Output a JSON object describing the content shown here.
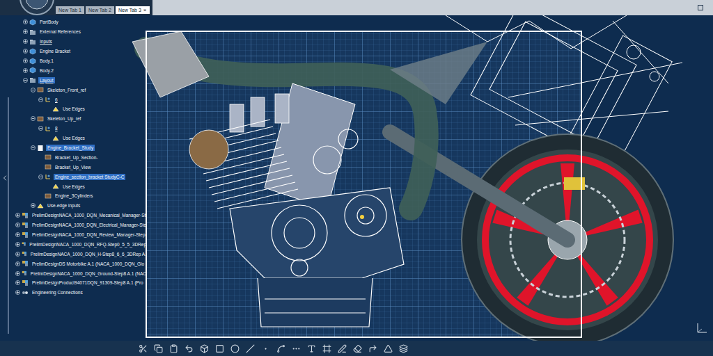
{
  "window": {
    "title": "New Tab 3"
  },
  "tabs": [
    {
      "label": "New Tab 1",
      "selected": false,
      "close": ""
    },
    {
      "label": "New Tab 2",
      "selected": false,
      "close": ""
    },
    {
      "label": "New Tab 3",
      "selected": true,
      "close": "×"
    }
  ],
  "tree": [
    {
      "label": "PartBody",
      "level": 1,
      "kind": "part",
      "expandable": true,
      "expanded": false,
      "selected": false,
      "underlined": false
    },
    {
      "label": "External References",
      "level": 1,
      "kind": "folder",
      "expandable": true,
      "expanded": false,
      "selected": false,
      "underlined": false
    },
    {
      "label": "Inputs",
      "level": 1,
      "kind": "folder",
      "expandable": true,
      "expanded": false,
      "selected": false,
      "underlined": true
    },
    {
      "label": "Engine Bracket",
      "level": 1,
      "kind": "part",
      "expandable": true,
      "expanded": false,
      "selected": false,
      "underlined": false
    },
    {
      "label": "Body.1",
      "level": 1,
      "kind": "part",
      "expandable": true,
      "expanded": false,
      "selected": false,
      "underlined": false
    },
    {
      "label": "Body.2",
      "level": 1,
      "kind": "part",
      "expandable": true,
      "expanded": false,
      "selected": false,
      "underlined": false
    },
    {
      "label": "Layout",
      "level": 1,
      "kind": "folder",
      "expandable": true,
      "expanded": true,
      "selected": true,
      "underlined": true
    },
    {
      "label": "Skeleton_Front_ref",
      "level": 2,
      "kind": "sketch",
      "expandable": true,
      "expanded": true,
      "selected": false,
      "underlined": false
    },
    {
      "label": "6",
      "level": 3,
      "kind": "axis",
      "expandable": true,
      "expanded": true,
      "selected": false,
      "underlined": true
    },
    {
      "label": "Use Edges",
      "level": 4,
      "kind": "edges",
      "expandable": false,
      "expanded": false,
      "selected": false,
      "underlined": false
    },
    {
      "label": "Skeleton_Up_ref",
      "level": 2,
      "kind": "sketch",
      "expandable": true,
      "expanded": true,
      "selected": false,
      "underlined": false
    },
    {
      "label": "8",
      "level": 3,
      "kind": "axis",
      "expandable": true,
      "expanded": true,
      "selected": false,
      "underlined": true
    },
    {
      "label": "Use Edges",
      "level": 4,
      "kind": "edges",
      "expandable": false,
      "expanded": false,
      "selected": false,
      "underlined": false
    },
    {
      "label": "Engine_Bracket_Study",
      "level": 2,
      "kind": "doc",
      "expandable": true,
      "expanded": true,
      "selected": true,
      "underlined": false
    },
    {
      "label": "Bracket_Up_Section-",
      "level": 3,
      "kind": "sketch",
      "expandable": false,
      "expanded": false,
      "selected": false,
      "underlined": false
    },
    {
      "label": "Bracket_Up_View",
      "level": 3,
      "kind": "sketch",
      "expandable": false,
      "expanded": false,
      "selected": false,
      "underlined": false
    },
    {
      "label": "Engine_section_bracket StudyC-C",
      "level": 3,
      "kind": "axis",
      "expandable": true,
      "expanded": true,
      "selected": true,
      "underlined": false
    },
    {
      "label": "Use Edges",
      "level": 4,
      "kind": "edges",
      "expandable": false,
      "expanded": false,
      "selected": false,
      "underlined": false
    },
    {
      "label": "Engine_3Cylinders",
      "level": 3,
      "kind": "sketch",
      "expandable": false,
      "expanded": false,
      "selected": false,
      "underlined": false
    },
    {
      "label": "Use-edge inputs",
      "level": 2,
      "kind": "edges",
      "expandable": true,
      "expanded": false,
      "selected": false,
      "underlined": false
    },
    {
      "label": "PrelimDesignNACA_1000_DQN_Mecanical_Manager-St",
      "level": 0,
      "kind": "product",
      "expandable": true,
      "expanded": false,
      "selected": false,
      "underlined": false
    },
    {
      "label": "PrelimDesignNACA_1000_DQN_Electrical_Manager-Ste",
      "level": 0,
      "kind": "product",
      "expandable": true,
      "expanded": false,
      "selected": false,
      "underlined": false
    },
    {
      "label": "PrelimDesignNACA_1000_DQN_Review_Manager-Step",
      "level": 0,
      "kind": "product",
      "expandable": true,
      "expanded": false,
      "selected": false,
      "underlined": false
    },
    {
      "label": "PrelimDesignNACA_1000_DQN_RFQ-Step0_5_5_3DRep",
      "level": 0,
      "kind": "product",
      "expandable": true,
      "expanded": false,
      "selected": false,
      "underlined": false
    },
    {
      "label": "PrelimDesignNACA_1000_DQN_H-Step8_6_6_3DRep A.",
      "level": 0,
      "kind": "product",
      "expandable": true,
      "expanded": false,
      "selected": false,
      "underlined": false
    },
    {
      "label": "PrelimDesignDS Motorbike A.1 (NACA_1000_DQN_Glo",
      "level": 0,
      "kind": "product",
      "expandable": true,
      "expanded": false,
      "selected": false,
      "underlined": false
    },
    {
      "label": "PrelimDesignNACA_1000_DQN_Ground-Step8 A.1 (NAC",
      "level": 0,
      "kind": "product",
      "expandable": true,
      "expanded": false,
      "selected": false,
      "underlined": false
    },
    {
      "label": "PrelimDesignProduct94071DQN_91309-Step8 A.1 (Pro",
      "level": 0,
      "kind": "product",
      "expandable": true,
      "expanded": false,
      "selected": false,
      "underlined": false
    },
    {
      "label": "Engineering Connections",
      "level": 0,
      "kind": "connect",
      "expandable": true,
      "expanded": false,
      "selected": false,
      "underlined": false
    }
  ]
}
